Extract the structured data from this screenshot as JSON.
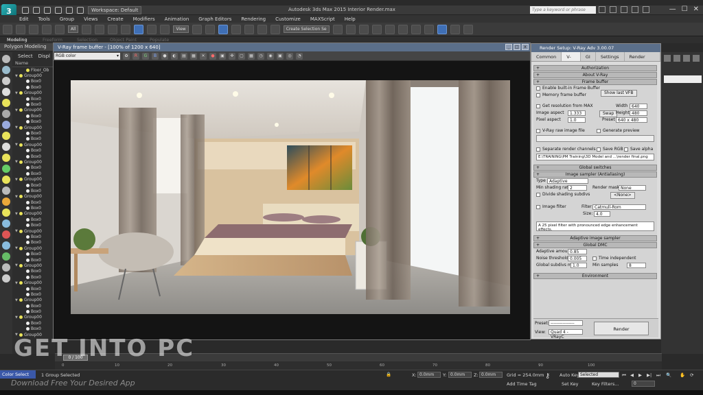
{
  "titlebar": {
    "workspace": "Workspace: Default",
    "title": "Autodesk 3ds Max 2015    Interior Render.max",
    "search_placeholder": "Type a keyword or phrase",
    "minimize": "—",
    "maximize": "☐",
    "close": "✕"
  },
  "menu": [
    "Edit",
    "Tools",
    "Group",
    "Views",
    "Create",
    "Modifiers",
    "Animation",
    "Graph Editors",
    "Rendering",
    "Customize",
    "MAXScript",
    "Help"
  ],
  "toolbar": {
    "filter_value": "All",
    "view_value": "View",
    "selection_set": "Create Selection Se"
  },
  "ribbon": {
    "tabs": [
      "Modeling",
      "Freeform",
      "Selection",
      "Object Paint",
      "Populate"
    ],
    "sub": "Polygon Modeling"
  },
  "explorer": {
    "tabs": [
      "Select",
      "Displ"
    ],
    "column": "Name",
    "rows": [
      {
        "name": "Floor_Ob",
        "kind": "bulb",
        "indent": 1
      },
      {
        "name": "Group00",
        "kind": "bulb",
        "indent": 0
      },
      {
        "name": "Box0",
        "kind": "dot",
        "indent": 1
      },
      {
        "name": "Box0",
        "kind": "dot",
        "indent": 1
      },
      {
        "name": "Group00",
        "kind": "bulb",
        "indent": 0
      },
      {
        "name": "Box0",
        "kind": "dot",
        "indent": 1
      },
      {
        "name": "Box0",
        "kind": "dot",
        "indent": 1
      },
      {
        "name": "Group00",
        "kind": "bulb",
        "indent": 0
      },
      {
        "name": "Box0",
        "kind": "dot",
        "indent": 1
      },
      {
        "name": "Box0",
        "kind": "dot",
        "indent": 1
      },
      {
        "name": "Group00",
        "kind": "bulb",
        "indent": 0
      },
      {
        "name": "Box0",
        "kind": "dot",
        "indent": 1
      },
      {
        "name": "Box0",
        "kind": "dot",
        "indent": 1
      },
      {
        "name": "Group00",
        "kind": "bulb",
        "indent": 0
      },
      {
        "name": "Box0",
        "kind": "dot",
        "indent": 1
      },
      {
        "name": "Box0",
        "kind": "dot",
        "indent": 1
      },
      {
        "name": "Group00",
        "kind": "bulb",
        "indent": 0
      },
      {
        "name": "Box0",
        "kind": "dot",
        "indent": 1
      },
      {
        "name": "Box0",
        "kind": "dot",
        "indent": 1
      },
      {
        "name": "Group00",
        "kind": "bulb",
        "indent": 0
      },
      {
        "name": "Box0",
        "kind": "dot",
        "indent": 1
      },
      {
        "name": "Box0",
        "kind": "dot",
        "indent": 1
      },
      {
        "name": "Group00",
        "kind": "bulb",
        "indent": 0
      },
      {
        "name": "Box0",
        "kind": "dot",
        "indent": 1
      },
      {
        "name": "Box0",
        "kind": "dot",
        "indent": 1
      },
      {
        "name": "Group00",
        "kind": "bulb",
        "indent": 0
      },
      {
        "name": "Box0",
        "kind": "dot",
        "indent": 1
      },
      {
        "name": "Box0",
        "kind": "dot",
        "indent": 1
      },
      {
        "name": "Group00",
        "kind": "bulb",
        "indent": 0
      },
      {
        "name": "Box0",
        "kind": "dot",
        "indent": 1
      },
      {
        "name": "Box0",
        "kind": "dot",
        "indent": 1
      },
      {
        "name": "Group00",
        "kind": "bulb",
        "indent": 0
      },
      {
        "name": "Box0",
        "kind": "dot",
        "indent": 1
      },
      {
        "name": "Box0",
        "kind": "dot",
        "indent": 1
      },
      {
        "name": "Group00",
        "kind": "bulb",
        "indent": 0
      },
      {
        "name": "Box0",
        "kind": "dot",
        "indent": 1
      },
      {
        "name": "Box0",
        "kind": "dot",
        "indent": 1
      },
      {
        "name": "Group00",
        "kind": "bulb",
        "indent": 0
      },
      {
        "name": "Box0",
        "kind": "dot",
        "indent": 1
      },
      {
        "name": "Box0",
        "kind": "dot",
        "indent": 1
      },
      {
        "name": "Group00",
        "kind": "bulb",
        "indent": 0
      },
      {
        "name": "Box0",
        "kind": "dot",
        "indent": 1
      },
      {
        "name": "Box0",
        "kind": "dot",
        "indent": 1
      },
      {
        "name": "Group00",
        "kind": "bulb",
        "indent": 0
      },
      {
        "name": "Box0",
        "kind": "dot",
        "indent": 1
      },
      {
        "name": "Box0",
        "kind": "dot",
        "indent": 1
      },
      {
        "name": "Group00",
        "kind": "bulb",
        "indent": 0
      }
    ]
  },
  "framebuffer": {
    "title": "V-Ray frame buffer - [100% of 1200 x 640]",
    "channel": "RGB color",
    "btn_r": "R",
    "btn_g": "G",
    "btn_b": "B"
  },
  "render_setup": {
    "title": "Render Setup: V-Ray Adv 3.00.07",
    "tabs": [
      "Common",
      "V-Ray",
      "GI",
      "Settings",
      "Render Elements"
    ],
    "authorization": "Authorization",
    "about": "About V-Ray",
    "frame_buffer": "Frame buffer",
    "enable_vfb": "Enable built-in Frame Buffer",
    "memory_fb": "Memory frame buffer",
    "show_last_vfb": "Show last VFB",
    "get_res": "Get resolution from MAX",
    "width_label": "Width",
    "width_value": "640",
    "height_label": "Height",
    "height_value": "480",
    "image_aspect_label": "Image aspect",
    "image_aspect_value": "1.333",
    "pixel_aspect_label": "Pixel aspect",
    "pixel_aspect_value": "1.0",
    "swap": "Swap",
    "preset_label": "Preset",
    "preset_value": "640 x 480",
    "raw_image": "V-Ray raw image file",
    "generate_preview": "Generate preview",
    "separate_channels": "Separate render channels",
    "save_rgb": "Save RGB",
    "save_alpha": "Save alpha",
    "output_path": "E:\\TRAINING\\PM Training\\3D Model and ...\\render final.png",
    "global_switches": "Global switches",
    "image_sampler": "Image sampler (Antialiasing)",
    "type_label": "Type",
    "type_value": "Adaptive",
    "min_shading_label": "Min shading rate",
    "min_shading_value": "2",
    "render_mask_label": "Render mask",
    "render_mask_value": "None",
    "divide_shading": "Divide shading subdivs",
    "none_btn": "<None>",
    "image_filter": "Image filter",
    "filter_label": "Filter",
    "filter_value": "Catmull-Rom",
    "size_label": "Size:",
    "size_value": "4.0",
    "filter_note": "A 25 pixel filter with pronounced edge enhancement effects.",
    "adaptive_sampler": "Adaptive image sampler",
    "global_dmc": "Global DMC",
    "adaptive_amount_label": "Adaptive amount",
    "adaptive_amount_value": "0.85",
    "noise_threshold_label": "Noise threshold",
    "noise_threshold_value": "0.005",
    "time_independent": "Time independent",
    "global_subdivs_label": "Global subdivs mult",
    "global_subdivs_value": "1.0",
    "min_samples_label": "Min samples",
    "min_samples_value": "8",
    "environment": "Environment",
    "preset_bottom_label": "Preset:",
    "preset_bottom_value": "----------------",
    "view_label": "View:",
    "view_value": "Quad 4 - VRayC",
    "render_button": "Render"
  },
  "timeline": {
    "frame_display": "0 / 100",
    "ticks": [
      "0",
      "10",
      "20",
      "30",
      "40",
      "50",
      "60",
      "70",
      "80",
      "90",
      "100"
    ]
  },
  "status": {
    "color_select": "Color Select",
    "group_selected": "1 Group Selected",
    "x_label": "X:",
    "x_value": "0.0mm",
    "y_label": "Y:",
    "y_value": "0.0mm",
    "z_label": "Z:",
    "z_value": "0.0mm",
    "grid": "Grid = 254.0mm",
    "add_time_tag": "Add Time Tag",
    "auto_key": "Auto Key",
    "selected": "Selected",
    "set_key": "Set Key",
    "key_filters": "Key Filters...",
    "frame_value": "0"
  },
  "watermark": {
    "brand": "GET INTO PC",
    "sub": "Download Free Your Desired App"
  }
}
